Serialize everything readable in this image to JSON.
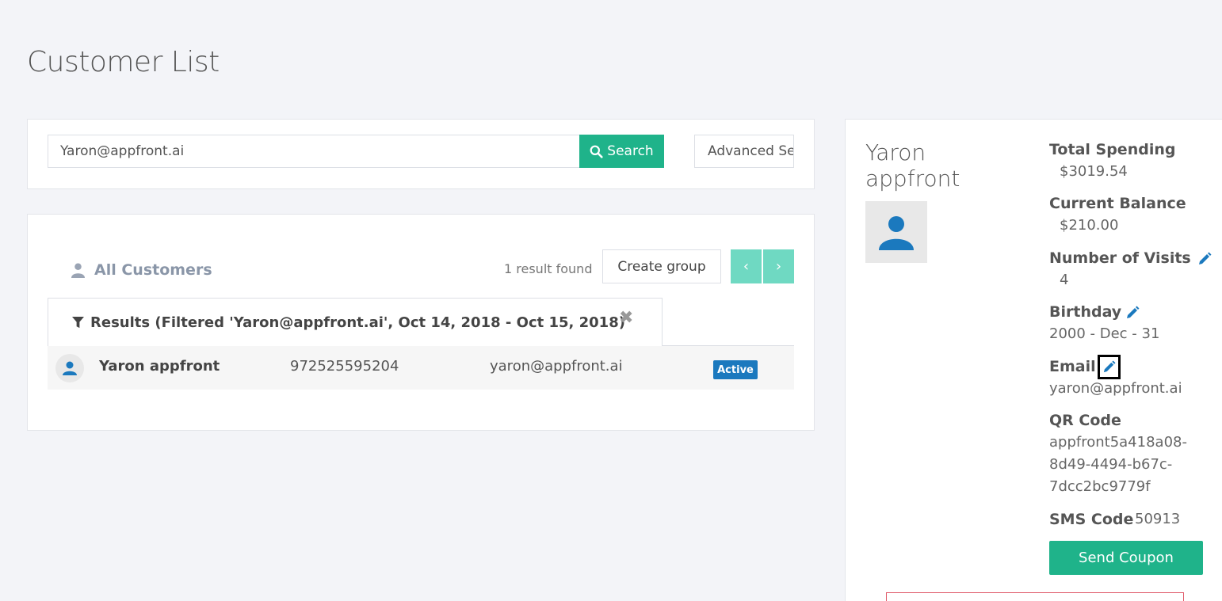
{
  "page": {
    "title": "Customer List"
  },
  "search": {
    "value": "Yaron@appfront.ai",
    "button_label": "Search",
    "advanced_label": "Advanced Search"
  },
  "list": {
    "heading": "All Customers",
    "result_count": "1 result found",
    "create_group_label": "Create group",
    "prev_label": "‹",
    "next_label": "›",
    "filter_label": "Results (Filtered 'Yaron@appfront.ai', Oct 14, 2018 - Oct 15, 2018)",
    "close_label": "✖",
    "rows": [
      {
        "name": "Yaron appfront",
        "phone": "972525595204",
        "email": "yaron@appfront.ai",
        "status": "Active"
      }
    ]
  },
  "detail": {
    "name": "Yaron appfront",
    "total_spending_label": "Total Spending",
    "total_spending": "$3019.54",
    "current_balance_label": "Current Balance",
    "current_balance": "$210.00",
    "visits_label": "Number of Visits",
    "visits": "4",
    "birthday_label": "Birthday",
    "birthday": "2000 - Dec - 31",
    "email_label": "Email",
    "email": "yaron@appfront.ai",
    "qr_label": "QR Code",
    "qr_line1": "appfront5a418a08-",
    "qr_line2": "8d49-4494-b67c-",
    "qr_line3": "7dcc2bc9779f",
    "sms_label": "SMS Code",
    "sms": "50913",
    "send_coupon_label": "Send Coupon"
  },
  "colors": {
    "accent_green": "#1fb38a",
    "nav_green": "#6fd9c2",
    "badge_blue": "#1b79be",
    "icon_blue": "#1b79be",
    "background": "#f3f4f8"
  }
}
